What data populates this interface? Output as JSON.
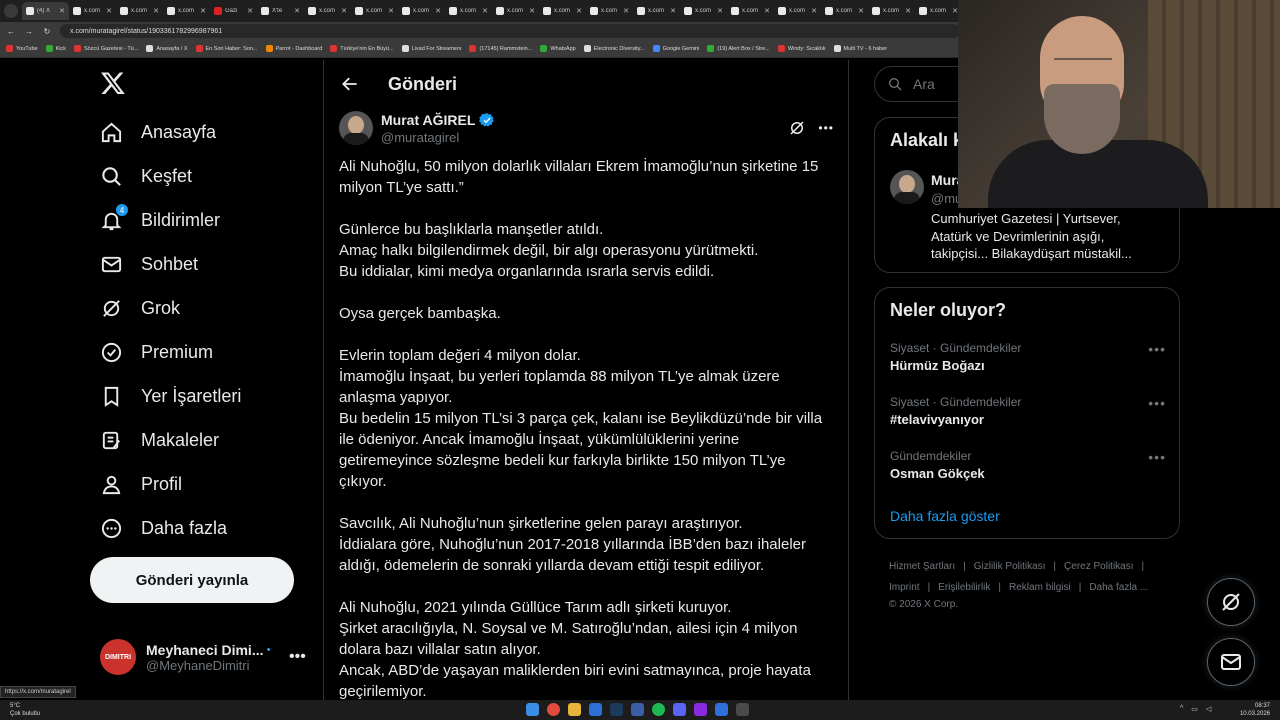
{
  "browser": {
    "tabs": [
      {
        "label": "(4) X",
        "active": true,
        "fav": "x"
      },
      {
        "label": "x.com",
        "fav": "x"
      },
      {
        "label": "x.com",
        "fav": "x"
      },
      {
        "label": "x.com",
        "fav": "x"
      },
      {
        "label": "Gazi",
        "fav": "red"
      },
      {
        "label": "X'te",
        "fav": "x"
      },
      {
        "label": "x.com",
        "fav": "x"
      },
      {
        "label": "x.com",
        "fav": "x"
      },
      {
        "label": "x.com",
        "fav": "x"
      },
      {
        "label": "x.com",
        "fav": "x"
      },
      {
        "label": "x.com",
        "fav": "x"
      },
      {
        "label": "x.com",
        "fav": "x"
      },
      {
        "label": "x.com",
        "fav": "x"
      },
      {
        "label": "x.com",
        "fav": "x"
      },
      {
        "label": "x.com",
        "fav": "x"
      },
      {
        "label": "x.com",
        "fav": "x"
      },
      {
        "label": "x.com",
        "fav": "x"
      },
      {
        "label": "x.com",
        "fav": "x"
      },
      {
        "label": "x.com",
        "fav": "x"
      },
      {
        "label": "x.com",
        "fav": "x"
      }
    ],
    "url": "x.com/muratagirel/status/1903361782996987961",
    "bookmarks": [
      {
        "label": "YouTube",
        "color": "r"
      },
      {
        "label": "Kick",
        "color": "g"
      },
      {
        "label": "Sözcü Gazetesi - Tü...",
        "color": "r"
      },
      {
        "label": "Anasayfa / X",
        "color": "w"
      },
      {
        "label": "En Son Haber: Son...",
        "color": "r"
      },
      {
        "label": "Parrot - Dashboard",
        "color": "o"
      },
      {
        "label": "Türkiye'nin En Büyü...",
        "color": "r"
      },
      {
        "label": "Livad For Streamers",
        "color": "w"
      },
      {
        "label": "(17145) Rammstein...",
        "color": "r"
      },
      {
        "label": "WhatsApp",
        "color": "g"
      },
      {
        "label": "Electronic Diversity...",
        "color": "w"
      },
      {
        "label": "Google Gemini",
        "color": "b"
      },
      {
        "label": "(19) Alert Box / Stre...",
        "color": "g"
      },
      {
        "label": "Windy: Sıcaklık",
        "color": "r"
      },
      {
        "label": "Multi TV - 6 haber",
        "color": "w"
      }
    ]
  },
  "nav": {
    "items": [
      {
        "label": "Anasayfa",
        "icon": "home-icon"
      },
      {
        "label": "Keşfet",
        "icon": "search-icon"
      },
      {
        "label": "Bildirimler",
        "icon": "bell-icon",
        "badge": "4"
      },
      {
        "label": "Sohbet",
        "icon": "mail-icon"
      },
      {
        "label": "Grok",
        "icon": "grok-icon"
      },
      {
        "label": "Premium",
        "icon": "verified-icon"
      },
      {
        "label": "Yer İşaretleri",
        "icon": "bookmark-icon"
      },
      {
        "label": "Makaleler",
        "icon": "article-icon"
      },
      {
        "label": "Profil",
        "icon": "person-icon"
      },
      {
        "label": "Daha fazla",
        "icon": "more-circle-icon"
      }
    ],
    "post_button": "Gönderi yayınla",
    "account": {
      "name": "Meyhaneci Dimi...",
      "handle": "@MeyhaneDimitri",
      "avatar_text": "DIMITRI"
    }
  },
  "main": {
    "title": "Gönderi",
    "author": {
      "name": "Murat AĞIREL",
      "handle": "@muratagirel"
    },
    "paragraphs": [
      [
        "Ali Nuhoğlu, 50 milyon dolarlık villaları Ekrem İmamoğlu’nun şirketine 15",
        "milyon TL’ye sattı.”"
      ],
      [
        "Günlerce bu başlıklarla manşetler atıldı.",
        "Amaç halkı bilgilendirmek değil, bir algı operasyonu yürütmekti.",
        "Bu iddialar, kimi medya organlarında ısrarla servis edildi."
      ],
      [
        "Oysa gerçek bambaşka."
      ],
      [
        "Evlerin toplam değeri 4 milyon dolar.",
        "İmamoğlu İnşaat, bu yerleri toplamda 88 milyon TL’ye almak üzere",
        "anlaşma yapıyor.",
        "Bu bedelin 15 milyon TL’si 3 parça çek, kalanı ise Beylikdüzü’nde bir villa",
        "ile ödeniyor. Ancak İmamoğlu İnşaat, yükümlülüklerini yerine",
        "getiremeyince sözleşme bedeli kur farkıyla birlikte 150 milyon TL’ye",
        "çıkıyor."
      ],
      [
        "Savcılık, Ali Nuhoğlu’nun şirketlerine gelen parayı araştırıyor.",
        "İddialara göre, Nuhoğlu’nun 2017-2018 yıllarında İBB’den bazı ihaleler",
        "aldığı, ödemelerin de sonraki yıllarda devam ettiği tespit ediliyor."
      ],
      [
        "Ali Nuhoğlu, 2021 yılında Güllüce Tarım adlı şirketi kuruyor.",
        "Şirket aracılığıyla, N. Soysal ve M. Satıroğlu’ndan, ailesi için 4 milyon",
        "dolara bazı villalar satın alıyor.",
        "Ancak, ABD’de yaşayan maliklerden biri evini satmayınca, proje hayata",
        "geçirilemiyor."
      ]
    ]
  },
  "right": {
    "search_placeholder": "Ara",
    "related": {
      "title": "Alakalı k",
      "name": "Mura",
      "handle": "@mu",
      "bio": "Cumhuriyet Gazetesi | Yurtsever, Atatürk ve Devrimlerinin aşığı, takipçisi... Bilakaydüşart müstakil..."
    },
    "trends": {
      "title": "Neler oluyor?",
      "items": [
        {
          "meta": "Siyaset · Gündemdekiler",
          "name": "Hürmüz Boğazı"
        },
        {
          "meta": "Siyaset · Gündemdekiler",
          "name": "#telavivyanıyor"
        },
        {
          "meta": "Gündemdekiler",
          "name": "Osman Gökçek"
        }
      ],
      "show_more": "Daha fazla göster"
    },
    "footer": {
      "row1": [
        "Hizmet Şartları",
        "Gizlilik Politikası",
        "Çerez Politikası"
      ],
      "row2": [
        "Imprint",
        "Erişilebilirlik",
        "Reklam bilgisi",
        "Daha fazla ..."
      ],
      "copyright": "© 2026 X Corp."
    }
  },
  "status_url": "https://x.com/muratagirel",
  "taskbar": {
    "weather_temp": "5°C",
    "weather_desc": "Çok bulutlu",
    "time": "08:37",
    "date": "10.03.2026"
  },
  "colors": {
    "accent": "#1d9bf0",
    "border": "#2f3336",
    "muted": "#71767b",
    "text": "#e7e9ea"
  }
}
